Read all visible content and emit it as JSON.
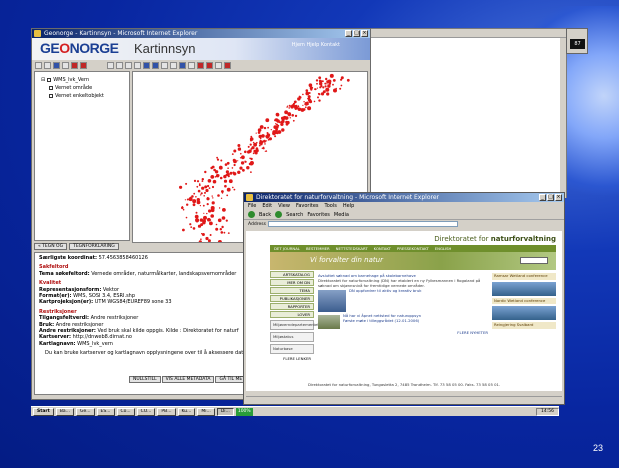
{
  "slide": {
    "number": "23"
  },
  "geonorge_window": {
    "title": "Geonorge - Kartinnsyn - Microsoft Internet Explorer",
    "logo": "GEONORGE",
    "page_title": "Kartinnsyn",
    "header_links": "Hjem  Hjelp  Kontakt",
    "layers": {
      "group": "WMS_lvk_Vern",
      "items": [
        "Vernet område",
        "Vernet enkeltobjekt"
      ]
    },
    "tabs": [
      "« TEGN OG",
      "TEGNFORKLARING"
    ],
    "info": {
      "coord_label": "Særligste koordinat:",
      "coord_value": "57.4563858460126",
      "sections": [
        {
          "heading": "Sakfeltord",
          "lines": [
            {
              "k": "Tema søkefeltord:",
              "v": "Vernede områder, naturmålkarter, landskapsvernområder"
            }
          ]
        },
        {
          "heading": "Kvalitet",
          "lines": [
            {
              "k": "Representasjonsform:",
              "v": "Vektor"
            },
            {
              "k": "Format(er):",
              "v": "WMS, SOSI 3.4, ESRI.shp"
            },
            {
              "k": "Kartprojeksjon(er):",
              "v": "UTM WGS84/EUREF89 sone 33"
            }
          ]
        },
        {
          "heading": "Restriksjoner",
          "lines": [
            {
              "k": "Tilgangsfeltverdi:",
              "v": "Andre restriksjoner"
            },
            {
              "k": "Bruk:",
              "v": "Andre restriksjoner"
            },
            {
              "k": "Andre restriksjoner:",
              "v": "Ved bruk skal kilde oppgis. Kilde : Direktoratet for naturf"
            },
            {
              "k": "Kartserver:",
              "v": "http://dnweb8.dirnat.no"
            },
            {
              "k": "Kartlagnavn:",
              "v": "WMS_lvk_vern"
            }
          ]
        }
      ],
      "note": "Du kan bruke kartserver og kartlagnavn opplysningene over til å aksessere data innen verktøy eller GIS system."
    },
    "bottom_buttons": [
      "NULLSTILL",
      "VIS ALLE METADATA",
      "GÅ TIL METAD"
    ]
  },
  "dn_window": {
    "title": "Direktoratet for naturforvaltning - Microsoft Internet Explorer",
    "menu": [
      "File",
      "Edit",
      "View",
      "Favorites",
      "Tools",
      "Help"
    ],
    "toolbar": [
      "Back",
      "Search",
      "Favorites",
      "Media"
    ],
    "address_label": "Address",
    "brand_prefix": "Direktoratet for",
    "brand_bold": "naturforvaltning",
    "nav": [
      "DET JOURNAL",
      "BESTEMMER",
      "NETTSTEDSKART",
      "KONTAKT",
      "PRESSEKONTAKT",
      "ENGLISH"
    ],
    "banner_tagline": "Vi forvalter din natur",
    "side_items": [
      "ARTSKATALOG",
      "MER OM DN",
      "TEMA",
      "PUBLIKASJONER",
      "RAPPORTER",
      "LOVER"
    ],
    "side_logos": [
      "Miljøverndepartementet",
      "Miljøstatus",
      "Naturbase"
    ],
    "side_bottom": "FLERE LENKER",
    "news": [
      "Avsluttet søknad om barnehage på skolebarnehave",
      "Direktoratet for naturforvaltning (DN) har etablert en ny Fylkesmannen i Rogaland på søknad om skjønnsnivå for fremtidige vernede områder.",
      "DN oppfordrer til aktiv og kreativ bruk",
      "Nå har vi åpnet nettsted for naturoppsyn",
      "Første møte i tilleggsrådet (12.01.2006)",
      "FLERE NYHETER"
    ],
    "right_boxes": [
      "Ramsar Wetland conference",
      "Nordic Wetland conference",
      "Reingjering Svalbard"
    ],
    "footer": "Direktoratet for naturforvaltning, Tungasletta 2, 7485 Trondheim. Tlf. 73 58 05 00. Faks. 73 58 05 01."
  },
  "taskbar": {
    "start": "Start",
    "tasks": [
      "",
      "Ba...",
      "Ge...",
      "ES...",
      "Co...",
      "CO...",
      "PB...",
      "Ku...",
      "Mi...",
      "Di..."
    ],
    "zoom": "100%",
    "clock": "14:56"
  },
  "corner_clock": "87"
}
